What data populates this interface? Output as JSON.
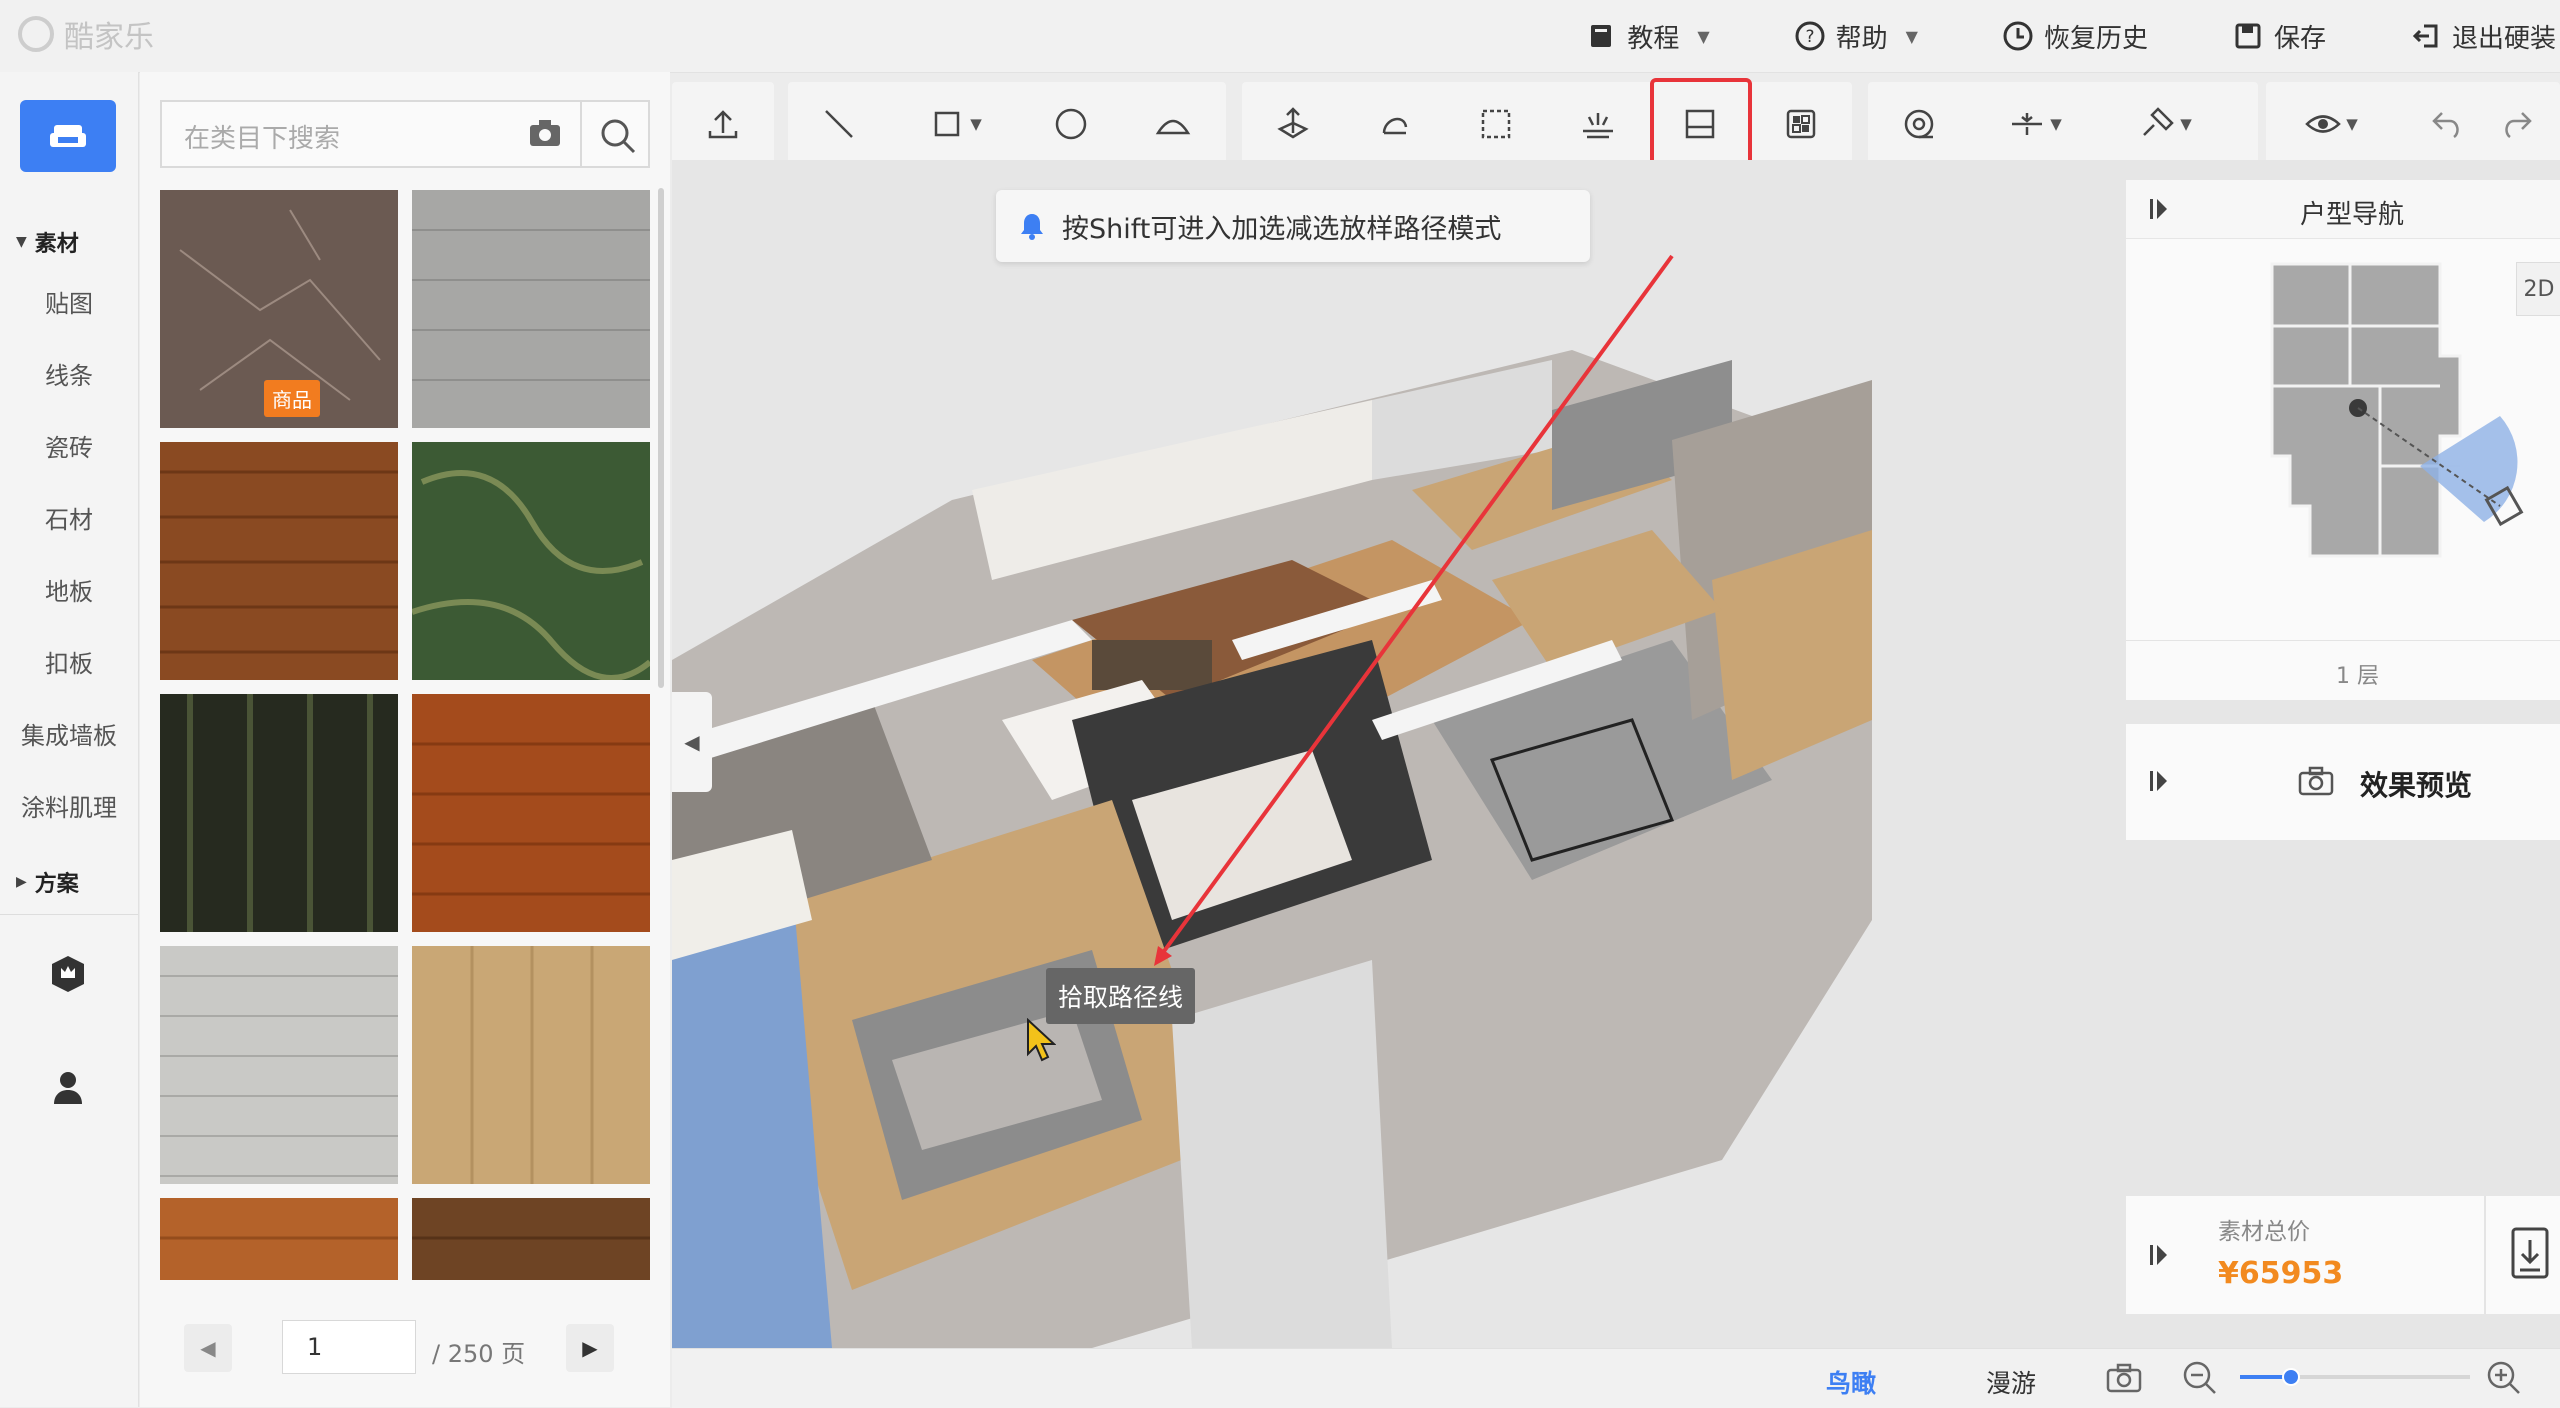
{
  "app": {
    "logo_text": "酷家乐"
  },
  "topmenu": [
    {
      "label": "教程",
      "icon": "book-icon",
      "has_dropdown": true
    },
    {
      "label": "帮助",
      "icon": "help-icon",
      "has_dropdown": true
    },
    {
      "label": "恢复历史",
      "icon": "clock-icon",
      "has_dropdown": false
    },
    {
      "label": "保存",
      "icon": "save-icon",
      "has_dropdown": false
    },
    {
      "label": "退出硬装",
      "icon": "exit-icon",
      "has_dropdown": false
    }
  ],
  "leftnav": {
    "section_material": "素材",
    "items": [
      "贴图",
      "线条",
      "瓷砖",
      "石材",
      "地板",
      "扣板",
      "集成墙板",
      "涂料肌理"
    ],
    "section_plan": "方案"
  },
  "library": {
    "search_placeholder": "在类目下搜索",
    "badge": "商品",
    "thumbnails": [
      {
        "name": "dark-marble",
        "color": "#6b5a52"
      },
      {
        "name": "grey-wood",
        "color": "#a7a7a5"
      },
      {
        "name": "walnut-wood",
        "color": "#8a4a22"
      },
      {
        "name": "green-marble",
        "color": "#3c5a34"
      },
      {
        "name": "black-wood",
        "color": "#262a1f"
      },
      {
        "name": "red-oak-wood",
        "color": "#a44b1c"
      },
      {
        "name": "white-wash-wood",
        "color": "#c9c9c6"
      },
      {
        "name": "light-oak-wood",
        "color": "#c9a775"
      },
      {
        "name": "orange-wood",
        "color": "#b4622a"
      },
      {
        "name": "brown-wood",
        "color": "#6e4424"
      }
    ],
    "pager": {
      "current": "1",
      "total_text": "/ 250 页"
    }
  },
  "toast": {
    "text": "按Shift可进入加选减选放样路径模式"
  },
  "tooltip": {
    "text": "拾取路径线"
  },
  "right_panel": {
    "floorplan_title": "户型导航",
    "view_2d_button": "2D",
    "floor_label": "1 层",
    "preview_label": "效果预览",
    "price_label": "素材总价",
    "price_value": "¥65953"
  },
  "bottombar": {
    "birdseye": "鸟瞰",
    "roam": "漫游",
    "zoom_level": 0.22
  },
  "colors": {
    "accent": "#3d7ff3",
    "price": "#f28a1f",
    "highlight": "#e8343a",
    "badge": "#f27c1f"
  }
}
